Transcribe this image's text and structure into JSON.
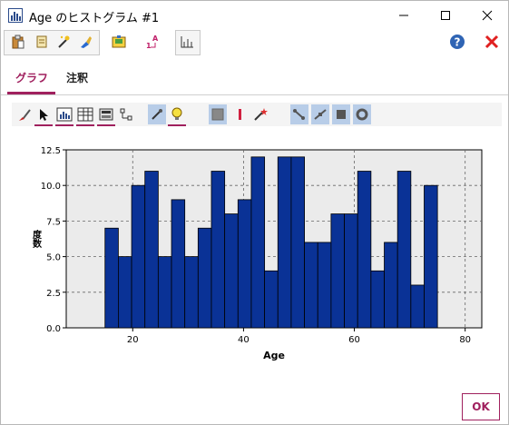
{
  "window": {
    "title": "Age のヒストグラム #1",
    "icons": {
      "app": "histogram-app-icon",
      "minimize": "minimize-icon",
      "maximize": "maximize-icon",
      "close": "close-icon"
    }
  },
  "toolbar": {
    "icons": [
      "clipboard-icon",
      "edit-icon",
      "magic-wand-icon",
      "brush-icon",
      "grid-export-icon",
      "sort-icon",
      "axis-icon",
      "help-icon",
      "exit-icon"
    ]
  },
  "tabs": [
    {
      "label": "グラフ",
      "active": true
    },
    {
      "label": "注釈",
      "active": false
    }
  ],
  "graph_toolbar": {
    "icons": [
      "brush-tool-icon",
      "pointer-tool-icon",
      "chart-frame-icon",
      "table-icon",
      "panel-icon",
      "node-icon",
      "explode-icon",
      "lightbulb-icon",
      "fill-icon",
      "line-color-icon",
      "wand-icon",
      "connect-line-icon",
      "step-line-icon",
      "square-marker-icon",
      "circle-marker-icon"
    ]
  },
  "colors": {
    "accent": "#a0205e",
    "bar": "#0a3296",
    "plot_bg": "#ebebeb",
    "help": "#2f64b4",
    "exit": "#e02020"
  },
  "chart_data": {
    "type": "bar",
    "xlabel": "Age",
    "ylabel": "度数",
    "xlim": [
      8,
      83
    ],
    "ylim": [
      0,
      12.5
    ],
    "xticks": [
      20,
      40,
      60,
      80
    ],
    "yticks": [
      "0.0",
      "2.5",
      "5.0",
      "7.5",
      "10.0",
      "12.5"
    ],
    "grid": true,
    "bins": [
      {
        "x0": 15.0,
        "x1": 17.4,
        "value": 7
      },
      {
        "x0": 17.4,
        "x1": 19.8,
        "value": 5
      },
      {
        "x0": 19.8,
        "x1": 22.2,
        "value": 10
      },
      {
        "x0": 22.2,
        "x1": 24.6,
        "value": 11
      },
      {
        "x0": 24.6,
        "x1": 27.0,
        "value": 5
      },
      {
        "x0": 27.0,
        "x1": 29.4,
        "value": 9
      },
      {
        "x0": 29.4,
        "x1": 31.8,
        "value": 5
      },
      {
        "x0": 31.8,
        "x1": 34.2,
        "value": 7
      },
      {
        "x0": 34.2,
        "x1": 36.6,
        "value": 11
      },
      {
        "x0": 36.6,
        "x1": 39.0,
        "value": 8
      },
      {
        "x0": 39.0,
        "x1": 41.4,
        "value": 9
      },
      {
        "x0": 41.4,
        "x1": 43.8,
        "value": 12
      },
      {
        "x0": 43.8,
        "x1": 46.2,
        "value": 4
      },
      {
        "x0": 46.2,
        "x1": 48.6,
        "value": 12
      },
      {
        "x0": 48.6,
        "x1": 51.0,
        "value": 12
      },
      {
        "x0": 51.0,
        "x1": 53.4,
        "value": 6
      },
      {
        "x0": 53.4,
        "x1": 55.8,
        "value": 6
      },
      {
        "x0": 55.8,
        "x1": 58.2,
        "value": 8
      },
      {
        "x0": 58.2,
        "x1": 60.6,
        "value": 8
      },
      {
        "x0": 60.6,
        "x1": 63.0,
        "value": 11
      },
      {
        "x0": 63.0,
        "x1": 65.4,
        "value": 4
      },
      {
        "x0": 65.4,
        "x1": 67.8,
        "value": 6
      },
      {
        "x0": 67.8,
        "x1": 70.2,
        "value": 11
      },
      {
        "x0": 70.2,
        "x1": 72.6,
        "value": 3
      },
      {
        "x0": 72.6,
        "x1": 75.0,
        "value": 10
      }
    ]
  },
  "buttons": {
    "ok": "OK"
  }
}
